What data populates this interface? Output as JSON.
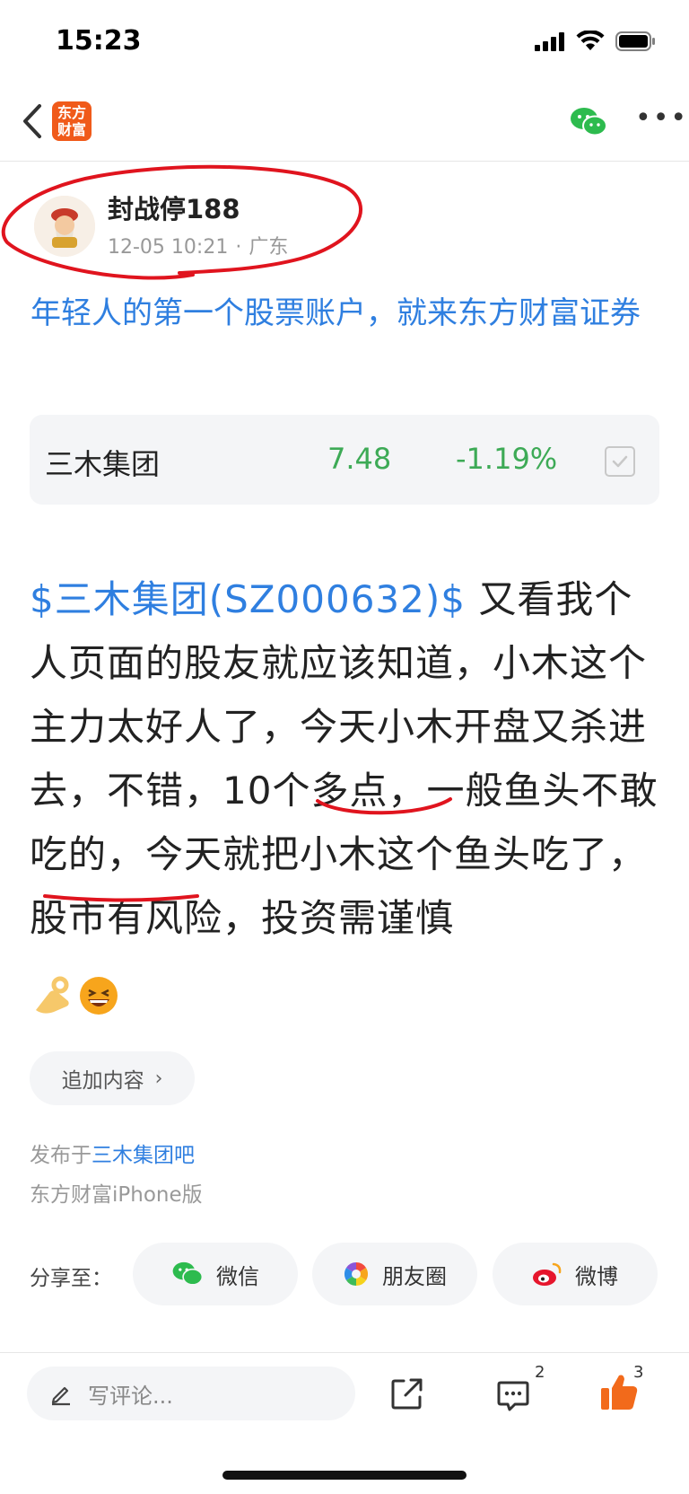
{
  "status_bar": {
    "time": "15:23"
  },
  "nav": {
    "logo_line1": "东方",
    "logo_line2": "财富"
  },
  "author": {
    "name": "封战停188",
    "datetime": "12-05 10:21",
    "separator": "·",
    "location": "广东"
  },
  "ad": {
    "text": "年轻人的第一个股票账户，就来东方财富证券"
  },
  "stock": {
    "name": "三木集团",
    "price": "7.48",
    "change": "-1.19%",
    "color": "#3daa56"
  },
  "post": {
    "tag": "$三木集团(SZ000632)$",
    "body": " 又看我个人页面的股友就应该知道，小木这个主力太好人了，今天小木开盘又杀进去，不错，10个多点，一般鱼头不敢吃的，今天就把小木这个鱼头吃了，股市有风险，投资需谨慎",
    "emojis": [
      "👌",
      "😆"
    ]
  },
  "add_content": {
    "label": "追加内容"
  },
  "published": {
    "prefix": "发布于",
    "bar": "三木集团吧",
    "client": "东方财富iPhone版"
  },
  "share": {
    "label": "分享至：",
    "wechat": "微信",
    "moments": "朋友圈",
    "weibo": "微博"
  },
  "bottom_bar": {
    "comment_placeholder": "写评论...",
    "comment_count": "2",
    "like_count": "3"
  },
  "colors": {
    "accent_blue": "#2f7fe0",
    "brand_orange": "#f05a1a",
    "like_orange": "#f26a1b",
    "annotation_red": "#e0141e"
  }
}
